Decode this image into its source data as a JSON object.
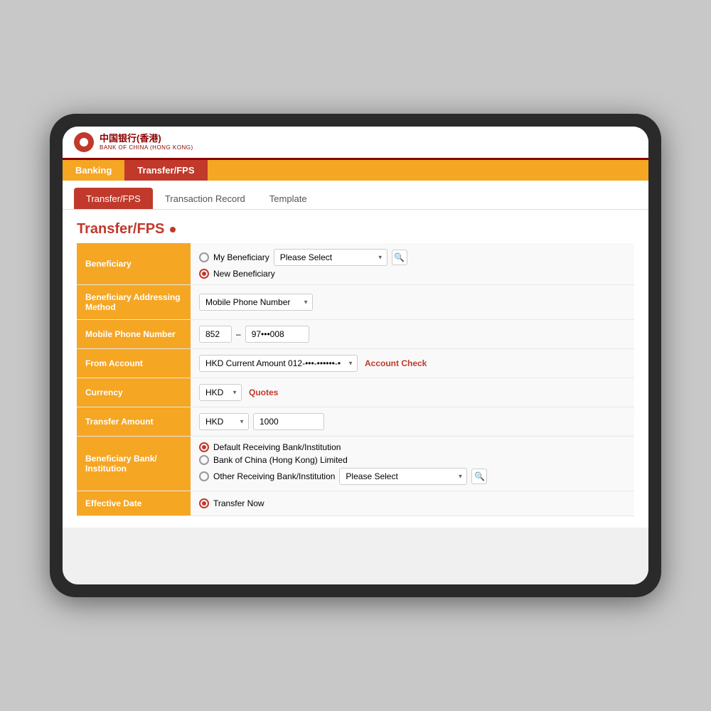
{
  "logo": {
    "cn_text": "中国银行(香港)",
    "en_text": "BANK OF CHINA (HONG KONG)"
  },
  "nav": {
    "items": [
      {
        "label": "Banking",
        "active": false
      },
      {
        "label": "Transfer/FPS",
        "active": true
      }
    ]
  },
  "tabs": {
    "items": [
      {
        "label": "Transfer/FPS",
        "active": true
      },
      {
        "label": "Transaction Record",
        "active": false
      },
      {
        "label": "Template",
        "active": false
      }
    ]
  },
  "form": {
    "title": "Transfer/FPS",
    "fields": {
      "beneficiary_label": "Beneficiary",
      "beneficiary_option1": "My Beneficiary",
      "beneficiary_option1_placeholder": "Please Select",
      "beneficiary_option2": "New Beneficiary",
      "beneficiary_method_label": "Beneficiary Addressing Method",
      "beneficiary_method_value": "Mobile Phone Number",
      "mobile_label": "Mobile Phone Number",
      "mobile_country": "852",
      "mobile_number": "97•••008",
      "from_account_label": "From Account",
      "from_account_value": "HKD Current Amount 012-•••-••••••-•",
      "account_check": "Account Check",
      "currency_label": "Currency",
      "currency_value": "HKD",
      "quotes_link": "Quotes",
      "transfer_amount_label": "Transfer Amount",
      "transfer_currency": "HKD",
      "transfer_amount_value": "1000",
      "bene_bank_label": "Beneficiary Bank/ Institution",
      "bene_bank_option1": "Default Receiving Bank/Institution",
      "bene_bank_option2": "Bank of China (Hong Kong) Limited",
      "bene_bank_option3": "Other Receiving Bank/Institution",
      "bene_bank_placeholder": "Please Select",
      "effective_date_label": "Effective Date",
      "effective_date_option1": "Transfer Now"
    }
  }
}
